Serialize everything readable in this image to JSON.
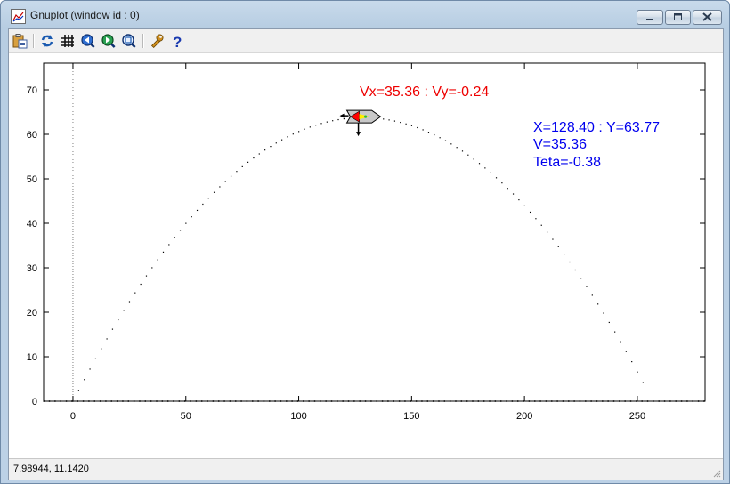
{
  "window": {
    "title": "Gnuplot (window id : 0)"
  },
  "toolbar": {
    "buttons": [
      {
        "name": "copy-print-button",
        "icon": "clipboard-icon"
      },
      {
        "name": "replot-button",
        "icon": "refresh-icon"
      },
      {
        "name": "grid-button",
        "icon": "grid-icon"
      },
      {
        "name": "zoom-previous-button",
        "icon": "zoom-back-icon"
      },
      {
        "name": "zoom-next-button",
        "icon": "zoom-forward-icon"
      },
      {
        "name": "autoscale-button",
        "icon": "zoom-fit-icon"
      },
      {
        "name": "options-button",
        "icon": "wrench-icon"
      },
      {
        "name": "help-button",
        "icon": "question-icon"
      }
    ]
  },
  "status": {
    "coordinates": "7.98944,  11.1420"
  },
  "annotations": {
    "velocity": "Vx=35.36 : Vy=-0.24",
    "position": "X=128.40 : Y=63.77",
    "speed": "V=35.36",
    "angle": "Teta=-0.38"
  },
  "colors": {
    "velocity_text": "#ee0000",
    "info_text": "#0000ee",
    "trajectory": "#000000"
  },
  "chart_data": {
    "type": "scatter",
    "title": "",
    "xlabel": "",
    "ylabel": "",
    "xlim": [
      -13,
      280
    ],
    "ylim": [
      0,
      76
    ],
    "x_ticks": [
      0,
      50,
      100,
      150,
      200,
      250
    ],
    "y_ticks": [
      0,
      10,
      20,
      30,
      40,
      50,
      60,
      70
    ],
    "grid": false,
    "series": [
      {
        "style": "dots",
        "trajectory": "parabola",
        "x_start": 0,
        "x_end": 253,
        "apex_x": 128.4,
        "apex_y": 63.77
      }
    ],
    "marker": {
      "shape": "rocket",
      "x": 128.4,
      "y": 63.77,
      "vx": 35.36,
      "vy": -0.24
    }
  }
}
